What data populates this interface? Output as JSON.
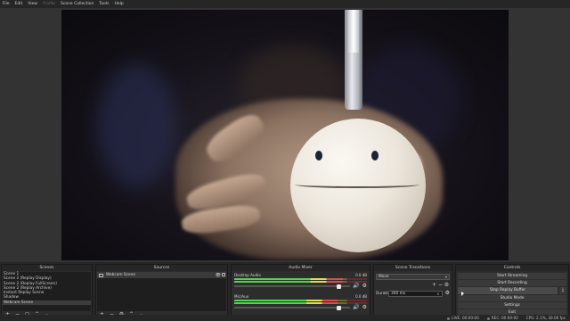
{
  "menu": [
    "File",
    "Edit",
    "View",
    "Profile",
    "Scene Collection",
    "Tools",
    "Help"
  ],
  "menu_disabled": [
    false,
    false,
    false,
    true,
    false,
    false,
    false
  ],
  "docks": {
    "scenes": {
      "title": "Scenes",
      "items": [
        "Scene 1",
        "Scene 2 (Replay Display)",
        "Scene 2 (Replay FullScreen)",
        "Scene 2 (Replay Archive)",
        "Instant Replay Scene",
        "Shadow",
        "Webcam Scene"
      ],
      "selected_index": 6
    },
    "sources": {
      "title": "Sources",
      "items": [
        "Webcam Scene"
      ]
    },
    "mixer": {
      "title": "Audio Mixer",
      "tracks": [
        {
          "name": "Desktop Audio",
          "db": "0.0 dB",
          "level": 0.82,
          "volume": 0.92
        },
        {
          "name": "Mic/Aux",
          "db": "0.0 dB",
          "level": 0.78,
          "volume": 0.92
        }
      ]
    },
    "transitions": {
      "title": "Scene Transitions",
      "transition": "Move",
      "duration_label": "Duration",
      "duration_value": "300 ms"
    },
    "controls": {
      "title": "Controls",
      "buttons": [
        "Start Streaming",
        "Start Recording",
        "Stop Replay Buffer",
        "Studio Mode",
        "Settings",
        "Exit"
      ],
      "active_index": 2
    }
  },
  "status": {
    "live": "LIVE: 00:00:00",
    "rec": "REC: 00:00:00",
    "cpu": "CPU: 2.1%, 30.00 fps"
  }
}
